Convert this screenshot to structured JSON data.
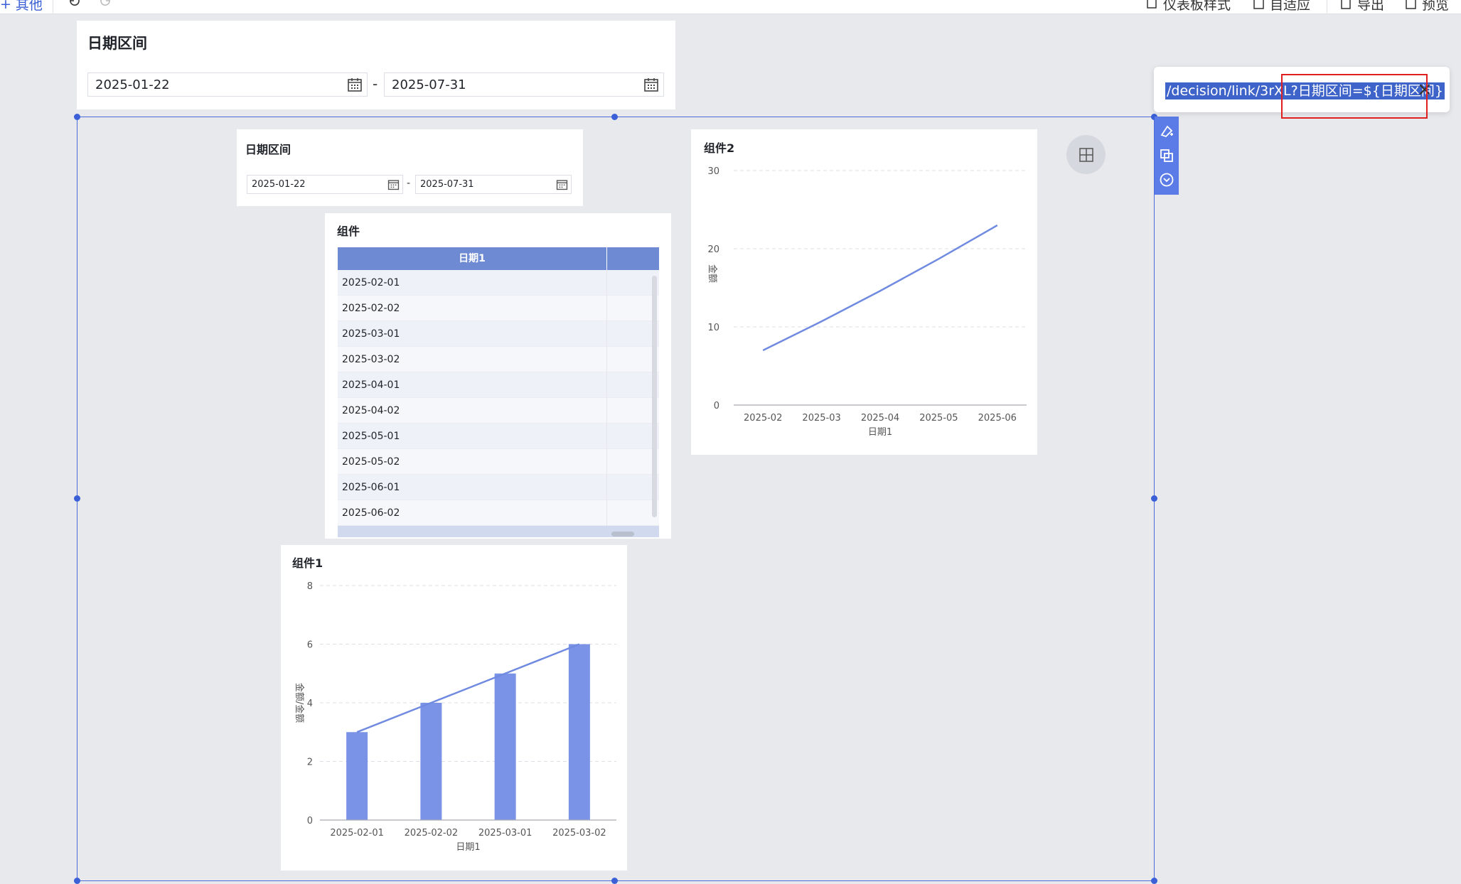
{
  "toolbar": {
    "left_label": "其他",
    "right_items": [
      "仪表板样式",
      "自适应",
      "导出",
      "预览"
    ]
  },
  "top_filter": {
    "title": "日期区间",
    "start": "2025-01-22",
    "end": "2025-07-31",
    "separator": "-"
  },
  "inner_filter": {
    "title": "日期区间",
    "start": "2025-01-22",
    "end": "2025-07-31",
    "separator": "-"
  },
  "table_widget": {
    "title": "组件",
    "header": "日期1",
    "rows": [
      "2025-02-01",
      "2025-02-02",
      "2025-03-01",
      "2025-03-02",
      "2025-04-01",
      "2025-04-02",
      "2025-05-01",
      "2025-05-02",
      "2025-06-01",
      "2025-06-02"
    ]
  },
  "url_popup": {
    "path": "/decision/link/3rXL?",
    "param": "日期区间=${日期区间}",
    "close": "×"
  },
  "colors": {
    "accent": "#5b7ce6",
    "bar": "#7b93e6",
    "line": "#6f8ae0",
    "selection": "#3f64c9",
    "highlight_box": "#e02020"
  },
  "icons": [
    "calendar-icon",
    "edit-style-icon",
    "copy-icon",
    "more-icon",
    "layout-icon",
    "close-icon"
  ],
  "chart_data": [
    {
      "type": "line",
      "title": "组件2",
      "xlabel": "日期1",
      "ylabel": "金额",
      "categories": [
        "2025-02",
        "2025-03",
        "2025-04",
        "2025-05",
        "2025-06"
      ],
      "values": [
        7,
        10.7,
        14.6,
        18.7,
        23
      ],
      "ylim": [
        0,
        30
      ],
      "yticks": [
        0,
        10,
        20,
        30
      ],
      "grid": true
    },
    {
      "type": "bar",
      "title": "组件1",
      "xlabel": "日期1",
      "ylabel": "金额/金额",
      "categories": [
        "2025-02-01",
        "2025-02-02",
        "2025-03-01",
        "2025-03-02"
      ],
      "series": [
        {
          "type": "bar",
          "values": [
            3,
            4,
            5,
            6
          ]
        },
        {
          "type": "line",
          "values": [
            3,
            4,
            5,
            6
          ]
        }
      ],
      "ylim": [
        0,
        8
      ],
      "yticks": [
        0,
        2,
        4,
        6,
        8
      ],
      "grid": true
    }
  ]
}
